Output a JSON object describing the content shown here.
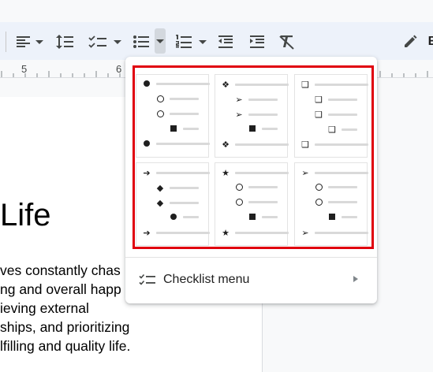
{
  "toolbar": {
    "icons": [
      "align-left-icon",
      "line-spacing-icon",
      "checklist-icon",
      "bulleted-list-icon",
      "numbered-list-icon",
      "decrease-indent-icon",
      "increase-indent-icon",
      "clear-formatting-icon",
      "pencil-edit-icon"
    ],
    "overflow_text": "E"
  },
  "ruler": {
    "numbers": [
      "5",
      "6"
    ]
  },
  "document": {
    "title_fragment": "Life",
    "lines": [
      "ves constantly chas",
      "ng and overall happ",
      "ieving external",
      "ships, and prioritizing",
      "lfilling and quality life."
    ]
  },
  "bullet_menu": {
    "highlight_color": "#e0000e",
    "styles": [
      {
        "name": "filled-dot",
        "glyphs": [
          "●",
          "○",
          "■",
          "●"
        ]
      },
      {
        "name": "diamond-arrowhead",
        "glyphs": [
          "❖",
          "➢",
          "■",
          "❖"
        ]
      },
      {
        "name": "shadow-square",
        "glyphs": [
          "❑",
          "❑",
          "❑",
          "❑"
        ]
      },
      {
        "name": "arrow-diamond",
        "glyphs": [
          "➔",
          "◆",
          "●",
          "➔"
        ]
      },
      {
        "name": "star-circle",
        "glyphs": [
          "★",
          "○",
          "■",
          "★"
        ]
      },
      {
        "name": "arrowhead-circle",
        "glyphs": [
          "➢",
          "○",
          "■",
          "➢"
        ]
      }
    ],
    "checklist_menu_label": "Checklist menu"
  }
}
